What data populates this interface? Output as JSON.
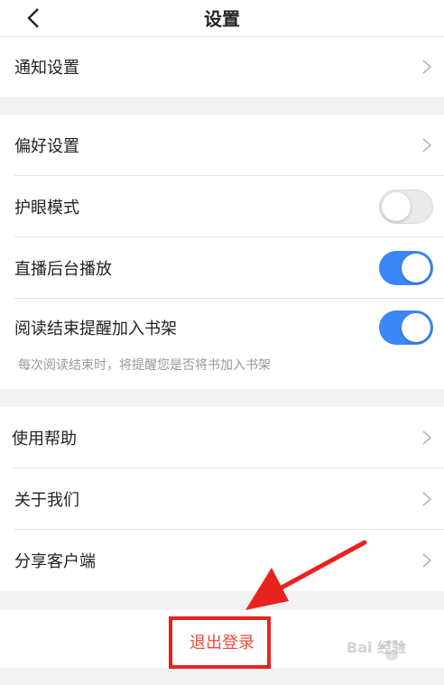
{
  "header": {
    "title": "设置",
    "back_icon": "chevron-left-icon"
  },
  "groups": {
    "notify": {
      "label": "通知设置"
    },
    "prefs": {
      "preference": "偏好设置",
      "eye_mode": "护眼模式",
      "live_bg": "直播后台播放",
      "reading_shelf": "阅读结束提醒加入书架",
      "reading_hint": "每次阅读结束时，将提醒您是否将书加入书架"
    },
    "about": {
      "help": "使用帮助",
      "about_us": "关于我们",
      "share": "分享客户端"
    }
  },
  "toggles": {
    "eye_mode": "off",
    "live_bg": "on",
    "reading_shelf": "on"
  },
  "logout": {
    "label": "退出登录"
  },
  "watermark": {
    "text": "Bai 经验"
  },
  "colors": {
    "toggle_on": "#3b87f5",
    "logout_text": "#e94b3c",
    "annotation_red": "#e8231d",
    "background": "#f2f2f2"
  }
}
